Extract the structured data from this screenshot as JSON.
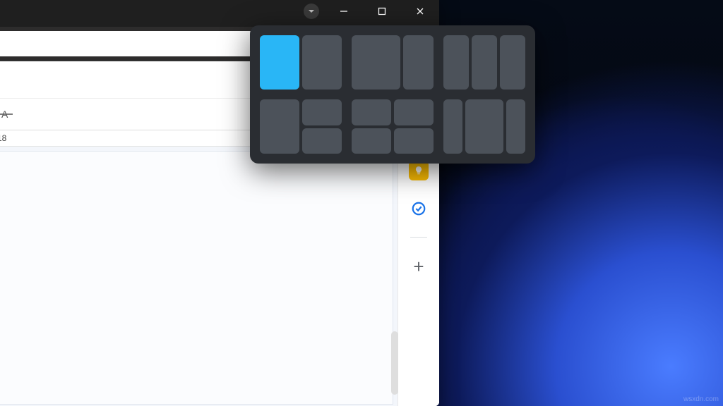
{
  "window": {
    "minimize": "–",
    "maximize": "▢",
    "close": "✕"
  },
  "row_label": "18",
  "watermark": "wsxdn.com",
  "side": {
    "plus": "+"
  },
  "snap": {
    "selected_layout": 0,
    "selected_zone": 0
  }
}
